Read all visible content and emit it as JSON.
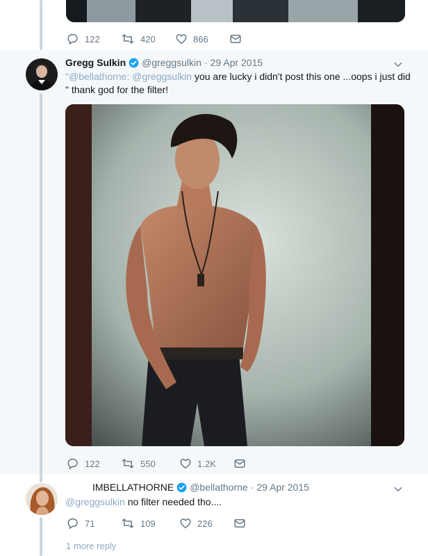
{
  "top_tweet": {
    "replies": "122",
    "retweets": "420",
    "likes": "866"
  },
  "main_tweet": {
    "name": "Gregg Sulkin",
    "handle": "@greggsulkin",
    "separator": "·",
    "time": "29 Apr 2015",
    "text_line1_quote": "\"",
    "text_line1_mention1": "@bellathorne",
    "text_line1_colon": ": ",
    "text_line1_mention2": "@greggsulkin",
    "text_line1_rest": " you are lucky i didn't post this one ...oops i just did",
    "text_line2": "\" thank god for the filter!",
    "replies": "122",
    "retweets": "550",
    "likes": "1.2K"
  },
  "reply_tweet": {
    "name": "IMBELLATHORNE",
    "handle": "@bellathorne",
    "separator": "·",
    "time": "29 Apr 2015",
    "mention": "@greggsulkin",
    "text": " no filter needed tho....",
    "replies": "71",
    "retweets": "109",
    "likes": "226"
  },
  "more_replies": "1 more reply",
  "colors": {
    "verified": "#1da1f2",
    "action_gray": "#657786",
    "link": "#1da1f2",
    "thread_line": "#ccd6dd",
    "highlight_bg": "#f5f8fa"
  },
  "icons": [
    "reply-icon",
    "retweet-icon",
    "like-icon",
    "direct-message-icon",
    "verified-badge-icon",
    "caret-down-icon"
  ]
}
